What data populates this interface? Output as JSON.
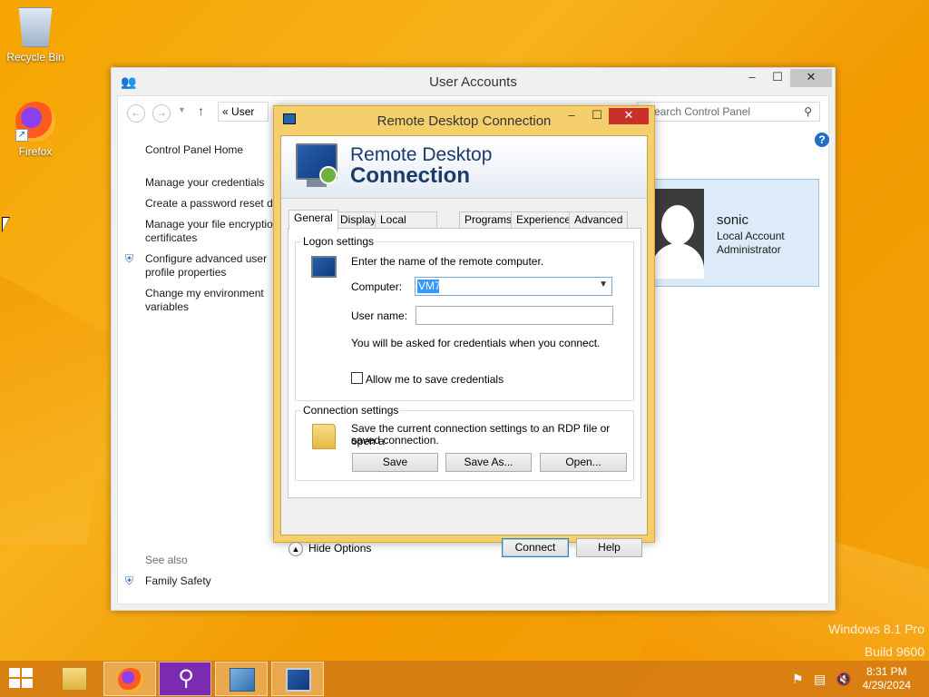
{
  "desktop": {
    "icons": [
      {
        "label": "Recycle Bin"
      },
      {
        "label": "Firefox"
      }
    ],
    "watermark": {
      "line1": "Windows 8.1 Pro",
      "line2": "Build 9600"
    }
  },
  "user_accounts": {
    "title": "User Accounts",
    "address_text": "User",
    "address_chevron": "«",
    "search_placeholder": "Search Control Panel",
    "sidebar": {
      "home": "Control Panel Home",
      "links": [
        "Manage your credentials",
        "Create a password reset dis",
        "Manage your file encryptio",
        "certificates",
        "Configure advanced user",
        "profile properties",
        "Change my environment",
        "variables"
      ],
      "see_also": "See also",
      "family_safety": "Family Safety"
    },
    "user": {
      "name": "sonic",
      "type": "Local Account",
      "role": "Administrator"
    }
  },
  "rdp": {
    "title": "Remote Desktop Connection",
    "banner_line1": "Remote Desktop",
    "banner_line2": "Connection",
    "tabs": [
      "General",
      "Display",
      "Local Resources",
      "Programs",
      "Experience",
      "Advanced"
    ],
    "active_tab": "General",
    "logon": {
      "legend": "Logon settings",
      "instruction": "Enter the name of the remote computer.",
      "computer_label": "Computer:",
      "computer_value": "VM7",
      "username_label": "User name:",
      "username_value": "",
      "credentials_note": "You will be asked for credentials when you connect.",
      "allow_save_label": "Allow me to save credentials",
      "allow_save_checked": false
    },
    "connection": {
      "legend": "Connection settings",
      "desc_line1": "Save the current connection settings to an RDP file or open a",
      "desc_line2": "saved connection.",
      "save": "Save",
      "save_as": "Save As...",
      "open": "Open..."
    },
    "hide_options": "Hide Options",
    "connect": "Connect",
    "help": "Help"
  },
  "taskbar": {
    "time": "8:31 PM",
    "date": "4/29/2024"
  },
  "colors": {
    "desktop_accent": "#f6a400",
    "rdp_frame": "#f5cf6c",
    "close_red": "#c9302c",
    "selection_blue": "#3399ff"
  }
}
